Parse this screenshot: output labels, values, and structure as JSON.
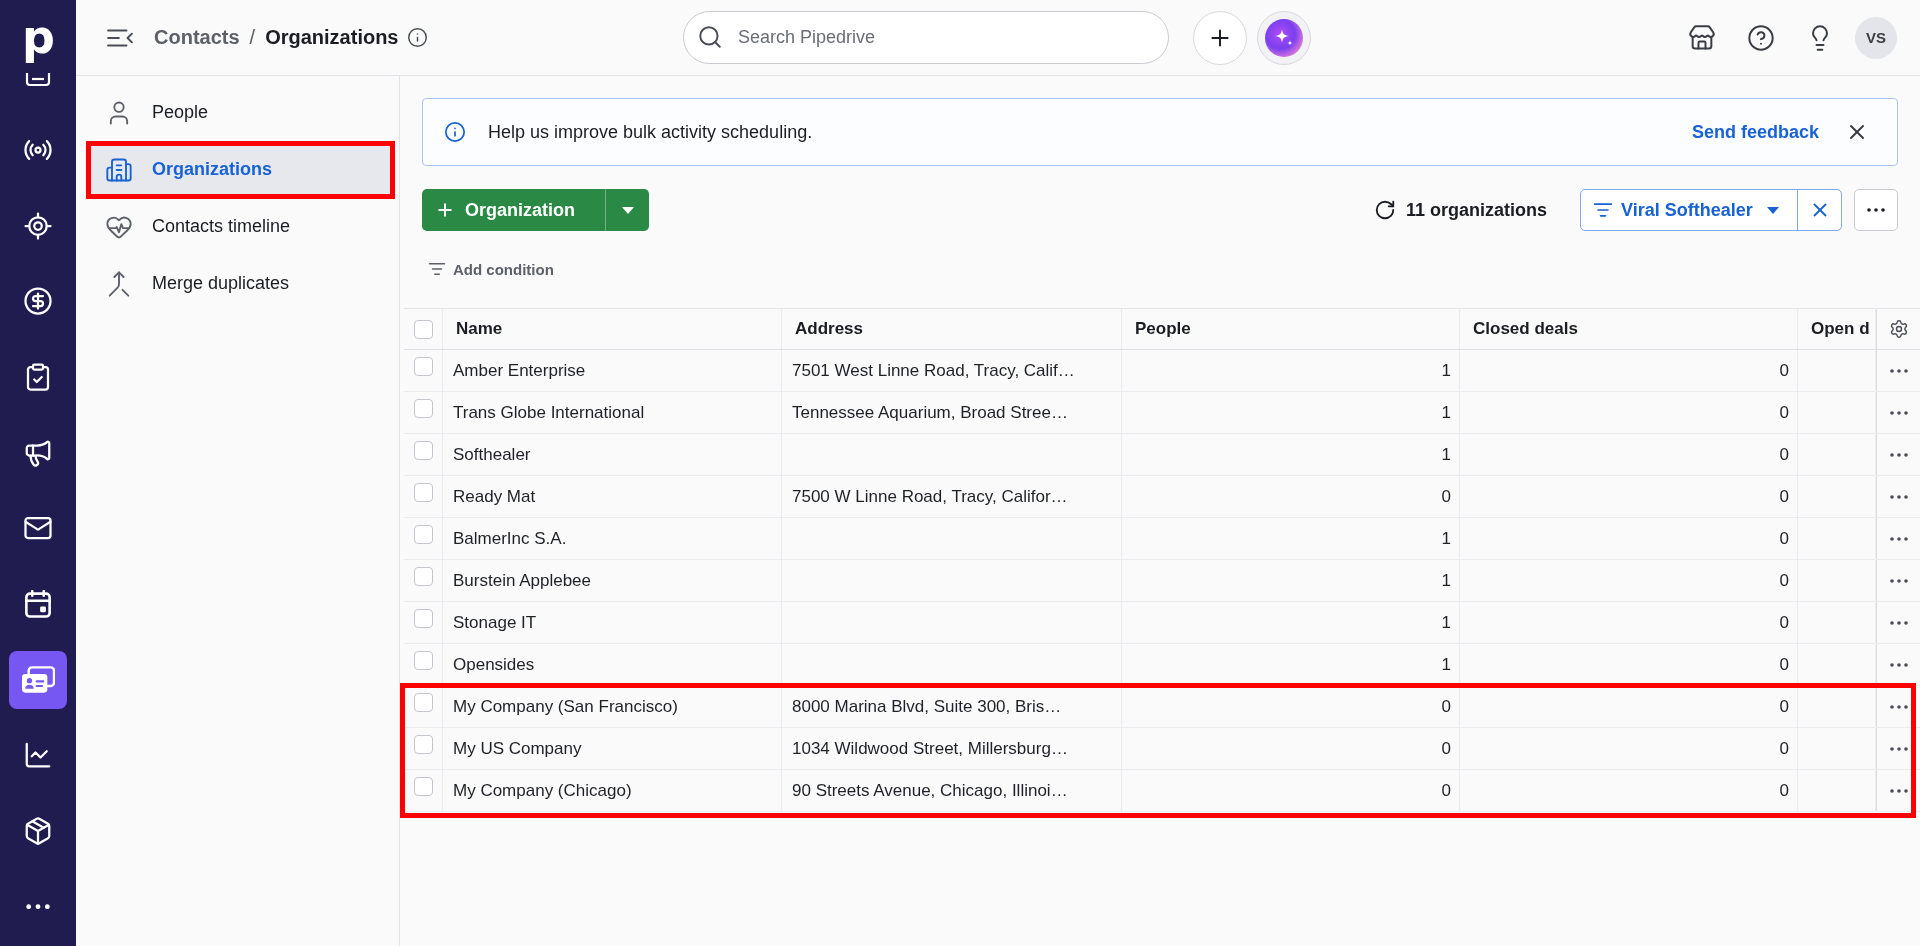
{
  "nav_rail": {
    "logo": "p",
    "items": [
      {
        "selected": false
      },
      {
        "selected": false
      },
      {
        "selected": false
      },
      {
        "selected": false
      },
      {
        "selected": false
      },
      {
        "selected": false
      },
      {
        "selected": false
      },
      {
        "selected": false
      },
      {
        "selected": true
      },
      {
        "selected": false
      },
      {
        "selected": false
      },
      {
        "selected": false
      }
    ]
  },
  "top_bar": {
    "breadcrumb": {
      "parent": "Contacts",
      "separator": "/",
      "current": "Organizations"
    },
    "search": {
      "placeholder": "Search Pipedrive"
    },
    "avatar": "VS"
  },
  "sidebar": {
    "items": [
      {
        "label": "People",
        "selected": false,
        "highlighted": false
      },
      {
        "label": "Organizations",
        "selected": true,
        "highlighted": true
      },
      {
        "label": "Contacts timeline",
        "selected": false,
        "highlighted": false
      },
      {
        "label": "Merge duplicates",
        "selected": false,
        "highlighted": false
      }
    ]
  },
  "banner": {
    "message": "Help us improve bulk activity scheduling.",
    "link": "Send feedback"
  },
  "toolbar": {
    "add_button": "Organization",
    "count": "11 organizations",
    "filter": "Viral Softhealer",
    "add_condition": "Add condition"
  },
  "table": {
    "select_all": {
      "checked": false
    },
    "columns": [
      {
        "label": "Name"
      },
      {
        "label": "Address"
      },
      {
        "label": "People"
      },
      {
        "label": "Closed deals"
      },
      {
        "label": "Open d"
      }
    ],
    "rows": [
      {
        "checked": false,
        "highlighted": false,
        "name": "Amber Enterprise",
        "address": "7501 West Linne Road, Tracy, Calif…",
        "people": "1",
        "closed_deals": "0"
      },
      {
        "checked": false,
        "highlighted": false,
        "name": "Trans Globe International",
        "address": "Tennessee Aquarium, Broad Stree…",
        "people": "1",
        "closed_deals": "0"
      },
      {
        "checked": false,
        "highlighted": false,
        "name": "Softhealer",
        "people": "1",
        "closed_deals": "0"
      },
      {
        "checked": false,
        "highlighted": false,
        "name": "Ready Mat",
        "address": "7500 W Linne Road, Tracy, Califor…",
        "people": "0",
        "closed_deals": "0"
      },
      {
        "checked": false,
        "highlighted": false,
        "name": "BalmerInc S.A.",
        "people": "1",
        "closed_deals": "0"
      },
      {
        "checked": false,
        "highlighted": false,
        "name": "Burstein Applebee",
        "people": "1",
        "closed_deals": "0"
      },
      {
        "checked": false,
        "highlighted": false,
        "name": "Stonage IT",
        "people": "1",
        "closed_deals": "0"
      },
      {
        "checked": false,
        "highlighted": false,
        "name": "Opensides",
        "people": "1",
        "closed_deals": "0"
      },
      {
        "checked": false,
        "highlighted": true,
        "name": "My Company (San Francisco)",
        "address": "8000 Marina Blvd, Suite 300, Bris…",
        "people": "0",
        "closed_deals": "0"
      },
      {
        "checked": false,
        "highlighted": true,
        "name": "My US Company",
        "address": "1034 Wildwood Street, Millersburg…",
        "people": "0",
        "closed_deals": "0"
      },
      {
        "checked": false,
        "highlighted": true,
        "name": "My Company (Chicago)",
        "address": "90 Streets Avenue, Chicago, Illinoi…",
        "people": "0",
        "closed_deals": "0"
      }
    ]
  }
}
